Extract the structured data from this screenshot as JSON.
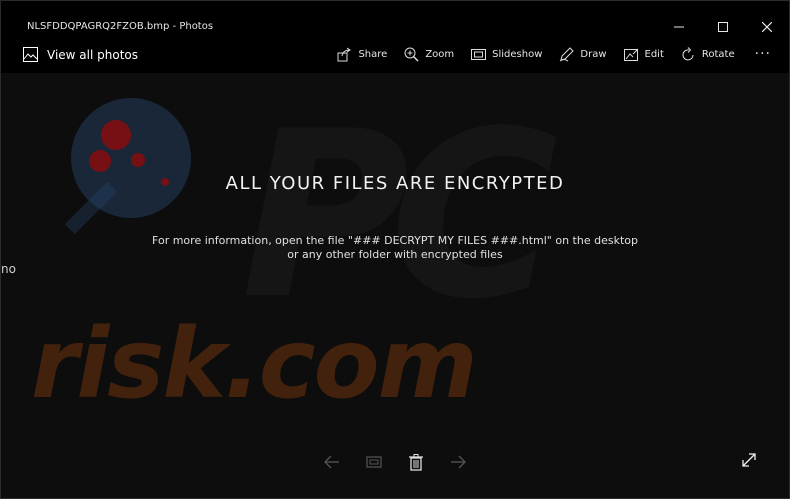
{
  "window": {
    "title": "NLSFDDQPAGRQ2FZOB.bmp - Photos",
    "min_icon": "minimize-icon",
    "max_icon": "maximize-icon",
    "close_icon": "close-icon"
  },
  "toolbar": {
    "view_all": "View all photos",
    "items": [
      {
        "label": "Share",
        "icon": "share-icon"
      },
      {
        "label": "Zoom",
        "icon": "zoom-icon"
      },
      {
        "label": "Slideshow",
        "icon": "slideshow-icon"
      },
      {
        "label": "Draw",
        "icon": "draw-icon"
      },
      {
        "label": "Edit",
        "icon": "edit-icon"
      },
      {
        "label": "Rotate",
        "icon": "rotate-icon"
      }
    ],
    "more_label": "···"
  },
  "image": {
    "headline": "ALL YOUR FILES ARE ENCRYPTED",
    "line1": "For more information, open the file \"### DECRYPT MY FILES ###.html\" on the desktop",
    "line2": "or any other folder with encrypted files",
    "left_clip_text": "no",
    "watermark_pc": "PC",
    "watermark_risk": "risk.com"
  },
  "colors": {
    "background": "#0d0d0d",
    "titlebar": "#000000",
    "watermark_orange": "#aa4b0f",
    "watermark_blue": "#28466e",
    "watermark_red": "#960a0a"
  }
}
